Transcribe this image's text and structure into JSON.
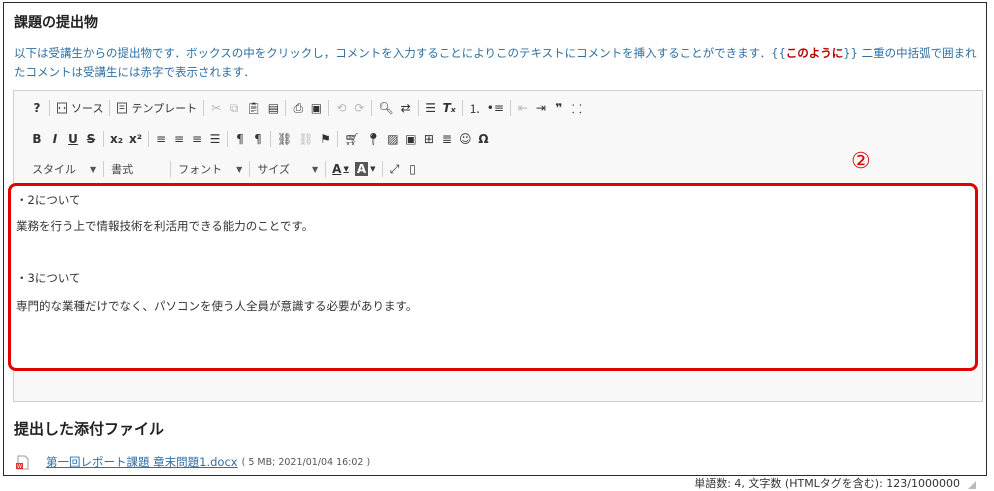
{
  "page": {
    "title": "課題の提出物",
    "description_part1": "以下は受講生からの提出物です．ボックスの中をクリックし，コメントを入力することによりこのテキストにコメントを挿入することができます．{{",
    "description_red": "このように",
    "description_part2": "}} 二重の中括弧で囲まれたコメントは受講生には赤字で表示されます．"
  },
  "toolbar": {
    "row1": [
      "?",
      "ソース",
      "テンプレート"
    ],
    "row2": [
      "B",
      "I",
      "U",
      "S",
      "x₂",
      "x²"
    ],
    "row3": {
      "style_label": "スタイル",
      "format_label": "書式",
      "font_label": "フォント",
      "size_label": "サイズ"
    }
  },
  "annotation": {
    "marker": "②",
    "color": "#e00000"
  },
  "editor": {
    "lines": [
      "・2について",
      "業務を行う上で情報技術を利活用できる能力のことです。",
      "・3について",
      "専門的な業種だけでなく、パソコンを使う人全員が意識する必要があります。"
    ],
    "status": "単語数: 4, 文字数 (HTMLタグを含む): 123/1000000"
  },
  "attachments": {
    "heading": "提出した添付ファイル",
    "file_name": "第一回レポート課題 章末問題1.docx",
    "file_meta": "( 5 MB; 2021/01/04 16:02 )"
  }
}
